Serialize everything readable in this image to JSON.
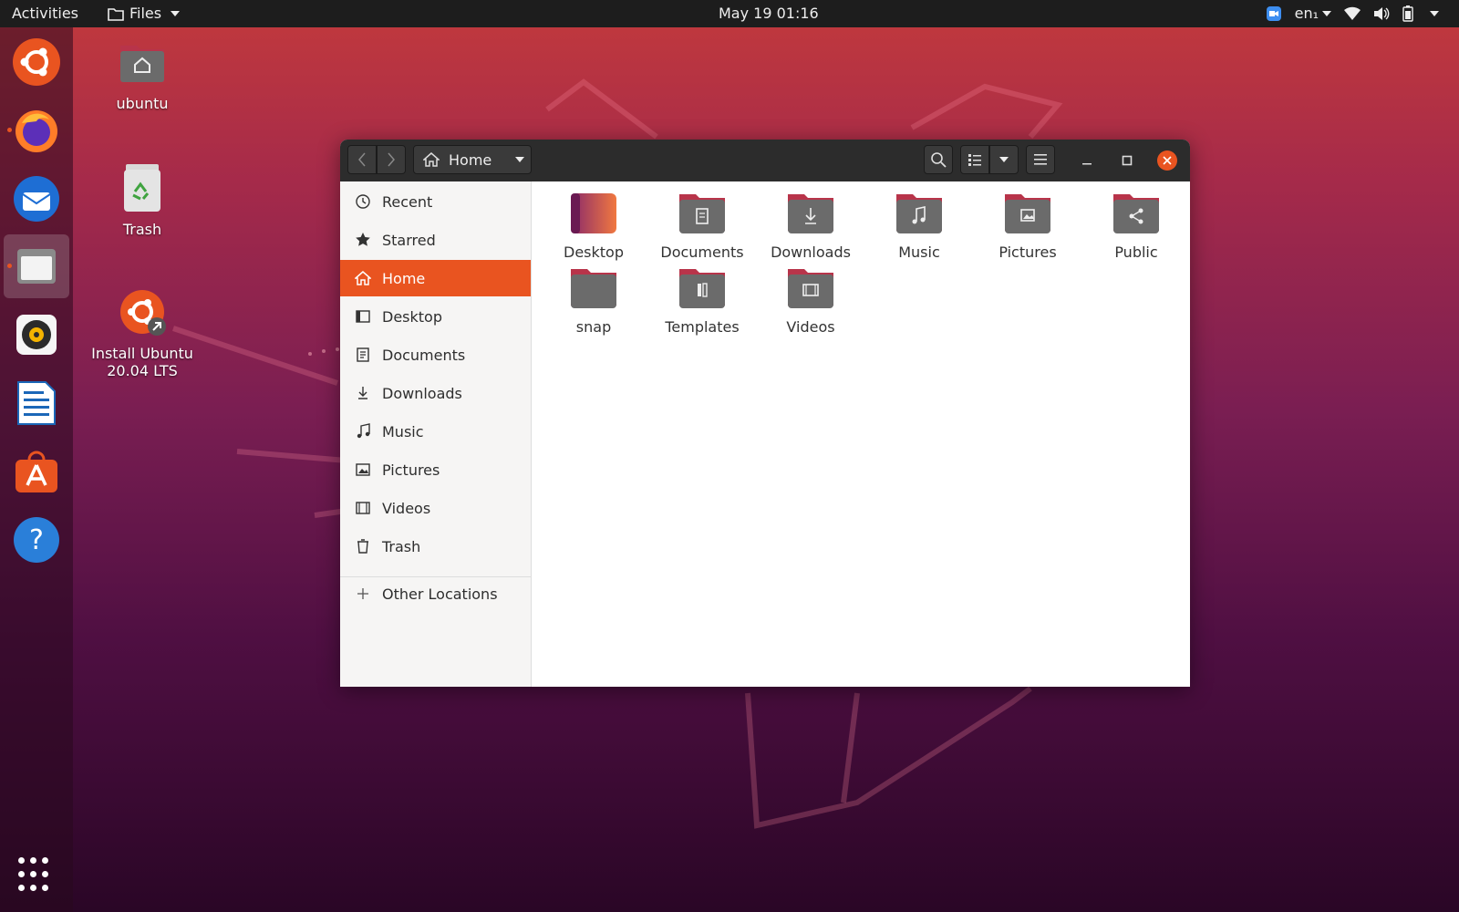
{
  "topbar": {
    "activities": "Activities",
    "app_name": "Files",
    "clock": "May 19  01:16",
    "lang": "en₁"
  },
  "desktop": {
    "icons": [
      {
        "label": "ubuntu"
      },
      {
        "label": "Trash"
      },
      {
        "label": "Install Ubuntu 20.04 LTS"
      }
    ]
  },
  "window": {
    "path_label": "Home",
    "sidebar": [
      {
        "label": "Recent",
        "icon": "clock-icon"
      },
      {
        "label": "Starred",
        "icon": "star-icon"
      },
      {
        "label": "Home",
        "icon": "home-icon",
        "selected": true
      },
      {
        "label": "Desktop",
        "icon": "desktop-icon"
      },
      {
        "label": "Documents",
        "icon": "document-icon"
      },
      {
        "label": "Downloads",
        "icon": "download-icon"
      },
      {
        "label": "Music",
        "icon": "music-icon"
      },
      {
        "label": "Pictures",
        "icon": "picture-icon"
      },
      {
        "label": "Videos",
        "icon": "video-icon"
      },
      {
        "label": "Trash",
        "icon": "trash-icon"
      }
    ],
    "other_locations": "Other Locations",
    "folders": [
      {
        "label": "Desktop",
        "icon": "desktop-folder-icon"
      },
      {
        "label": "Documents",
        "icon": "documents-folder-icon"
      },
      {
        "label": "Downloads",
        "icon": "downloads-folder-icon"
      },
      {
        "label": "Music",
        "icon": "music-folder-icon"
      },
      {
        "label": "Pictures",
        "icon": "pictures-folder-icon"
      },
      {
        "label": "Public",
        "icon": "public-folder-icon"
      },
      {
        "label": "snap",
        "icon": "folder-icon"
      },
      {
        "label": "Templates",
        "icon": "templates-folder-icon"
      },
      {
        "label": "Videos",
        "icon": "videos-folder-icon"
      }
    ]
  },
  "colors": {
    "accent": "#e95420",
    "folder_body": "#6b6b6b",
    "folder_tab": "#b8344a"
  }
}
